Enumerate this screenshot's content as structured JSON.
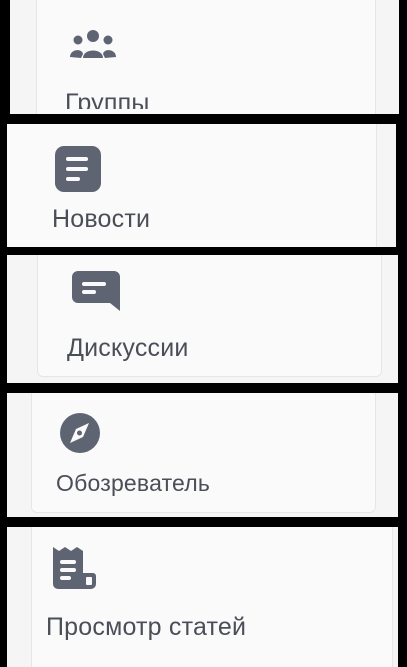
{
  "menu": {
    "items": [
      {
        "label": "Группы",
        "icon": "groups-icon"
      },
      {
        "label": "Новости",
        "icon": "news-icon"
      },
      {
        "label": "Дискуссии",
        "icon": "discussions-icon"
      },
      {
        "label": "Обозреватель",
        "icon": "compass-icon"
      },
      {
        "label": "Просмотр статей",
        "icon": "articles-icon"
      }
    ]
  },
  "colors": {
    "icon": "#5f6473",
    "text": "#4b4e57",
    "card_background": "#fafafb",
    "separator": "#000000"
  }
}
